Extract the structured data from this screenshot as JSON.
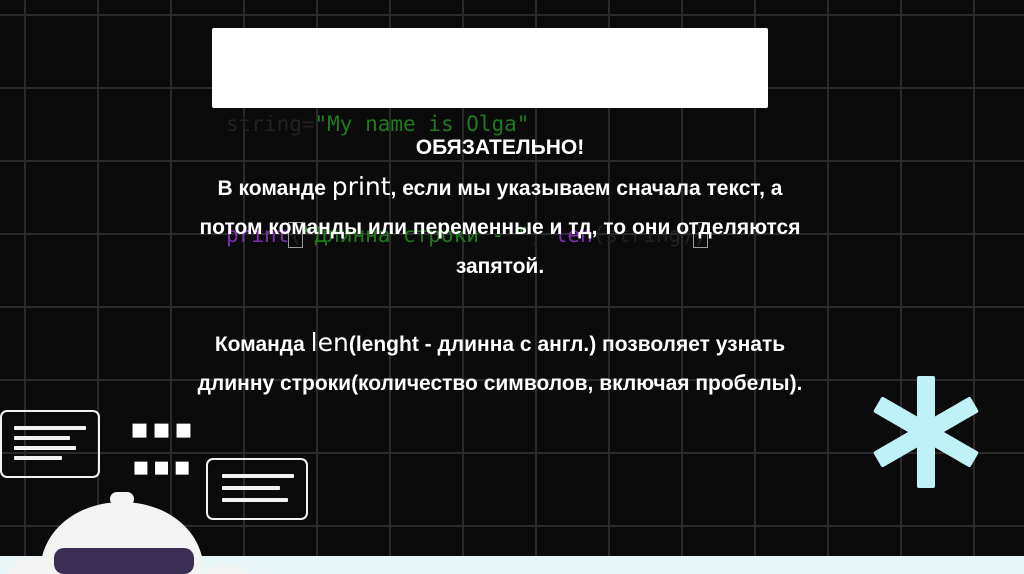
{
  "code": {
    "line1": {
      "a": "string=",
      "b": "\"My name is Olga\""
    },
    "line2": {
      "fn": "print",
      "open": "(",
      "str": "\"Длинна строки - \"",
      "comma": ", ",
      "len": "len",
      "arg": "(string)",
      "close": ")"
    }
  },
  "notes": {
    "title": "ОБЯЗАТЕЛЬНО!",
    "p1_before": "В команде ",
    "p1_code": "print",
    "p1_after": ", если мы указываем сначала текст, а",
    "p1_line2": "потом команды или переменные и тд, то они отделяются",
    "p1_line3": "запятой.",
    "p2_before": "Команда ",
    "p2_code": "len",
    "p2_after": "(lenght - длинна с англ.) позволяет узнать",
    "p2_line2": "длинну строки(количество символов, включая пробелы)."
  },
  "decor": {
    "dots1": "▪▪▪",
    "dots2": "▪▪▪",
    "accent_color": "#bff2f6",
    "grid_color": "#2a2a2a",
    "background_color": "#0b0b0b"
  }
}
